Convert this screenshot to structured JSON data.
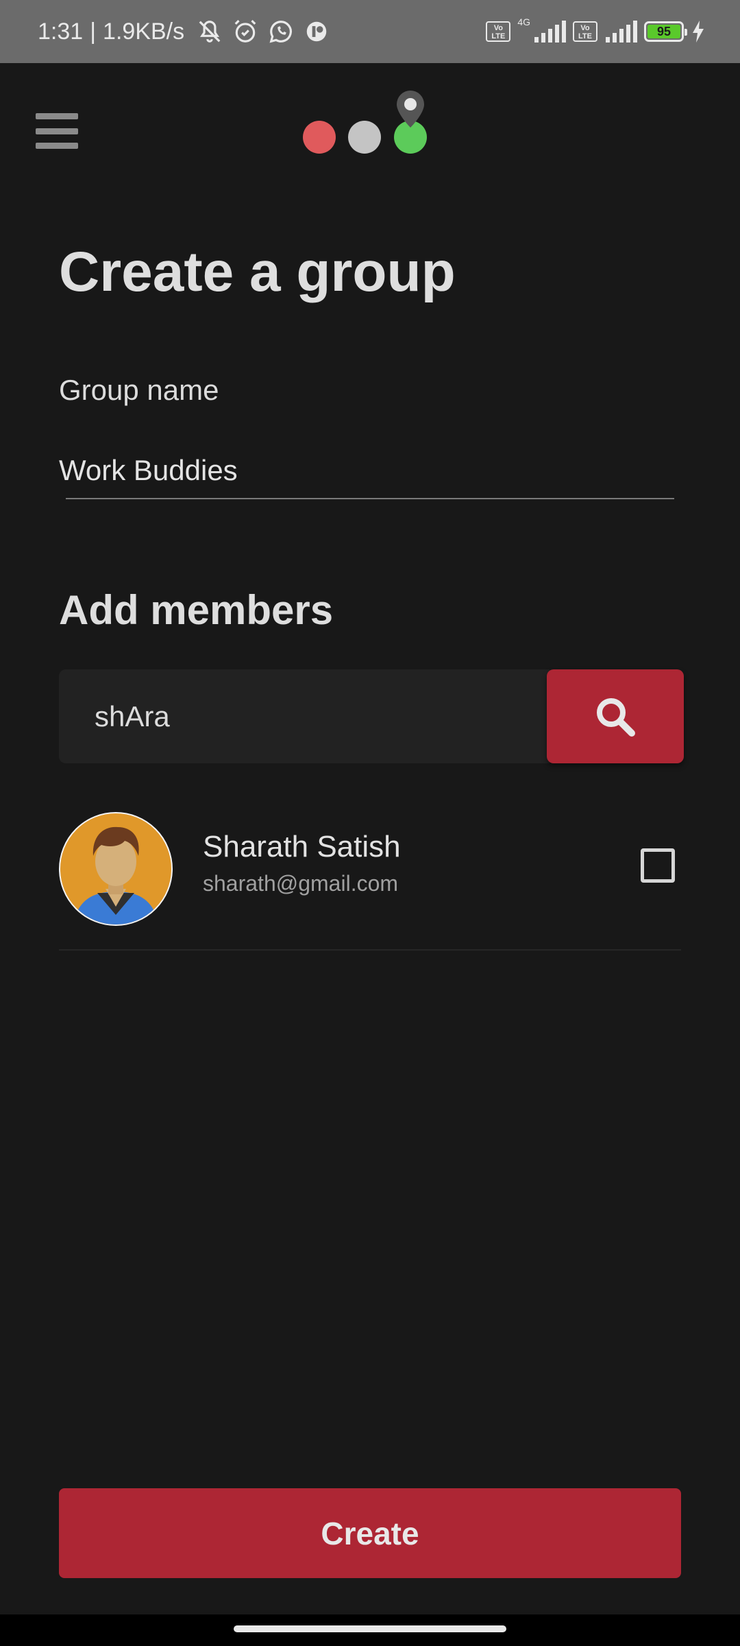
{
  "status_bar": {
    "time": "1:31",
    "network_speed": "1.9KB/s",
    "icons": [
      "mute-icon",
      "alarm-icon",
      "whatsapp-icon",
      "app-notification-icon"
    ],
    "volte_1": "Vo LTE",
    "network_type": "4G",
    "volte_2": "Vo LTE",
    "battery": "95",
    "charging": true
  },
  "header": {
    "menu_icon": "hamburger-menu-icon",
    "logo": {
      "dot_colors": [
        "#e05a5c",
        "#c4c4c4",
        "#5ccb5a"
      ],
      "pin_color": "#555555"
    }
  },
  "page": {
    "title": "Create a group",
    "group_name_label": "Group name",
    "group_name_value": "Work Buddies",
    "add_members_title": "Add members",
    "search_value": "shAra",
    "search_icon": "search-icon"
  },
  "members": [
    {
      "name": "Sharath Satish",
      "email": "sharath@gmail.com",
      "checked": false
    }
  ],
  "actions": {
    "create_label": "Create"
  },
  "colors": {
    "background": "#181818",
    "accent": "#ad2634",
    "status_bar": "#6b6b6b"
  }
}
